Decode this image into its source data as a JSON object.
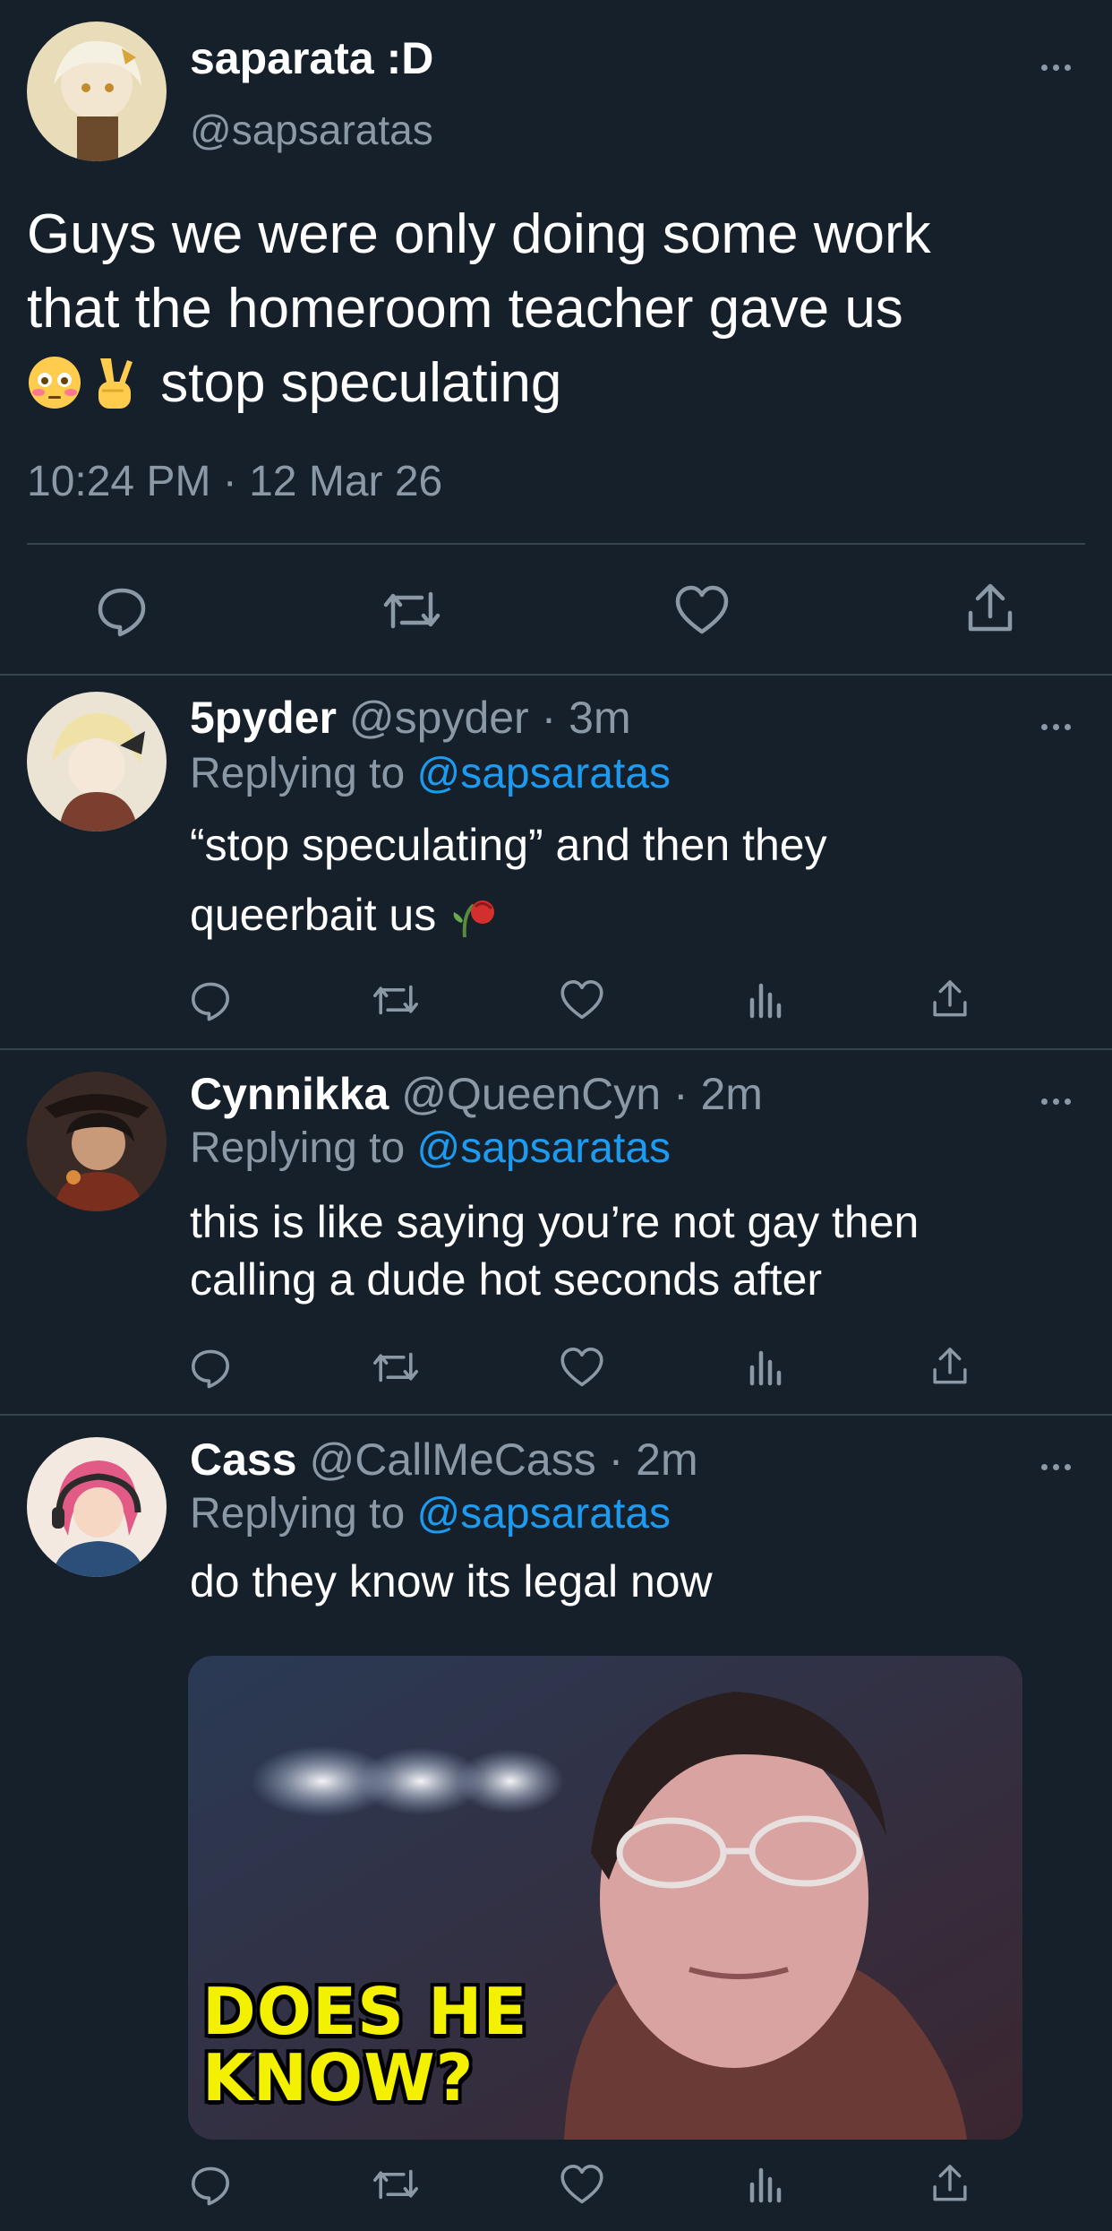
{
  "main_tweet": {
    "name": "saparata :D",
    "handle": "@sapsaratas",
    "text_line1": "Guys we were only doing some work",
    "text_line2": "that the homeroom teacher gave us",
    "text_line3": "stop speculating",
    "emojis": [
      "flushed-face",
      "victory-hand"
    ],
    "timestamp": "10:24 PM · 12 Mar 26"
  },
  "replies": [
    {
      "name": "5pyder",
      "handle": "@spyder",
      "time": "· 3m",
      "replying_prefix": "Replying to",
      "replying_to": "@sapsaratas",
      "text_line1": "“stop speculating” and then they",
      "text_line2": "queerbait us",
      "emoji": "wilted-flower"
    },
    {
      "name": "Cynnikka",
      "handle": "@QueenCyn",
      "time": "· 2m",
      "replying_prefix": "Replying to",
      "replying_to": "@sapsaratas",
      "text_line1": "this is like saying you’re not gay then",
      "text_line2": "calling a dude hot seconds after"
    },
    {
      "name": "Cass",
      "handle": "@CallMeCass",
      "time": "· 2m",
      "replying_prefix": "Replying to",
      "replying_to": "@sapsaratas",
      "text_line1": "do they know its legal now",
      "media_caption_line1": "DOES HE",
      "media_caption_line2": "KNOW?"
    }
  ],
  "icons": [
    "reply-icon",
    "retweet-icon",
    "like-icon",
    "views-icon",
    "share-icon",
    "more-icon"
  ],
  "colors": {
    "background": "#15202b",
    "text": "#ffffff",
    "muted": "#8b98a5",
    "link": "#1d9bf0",
    "divider": "#38444d",
    "caption": "#f3f000"
  }
}
